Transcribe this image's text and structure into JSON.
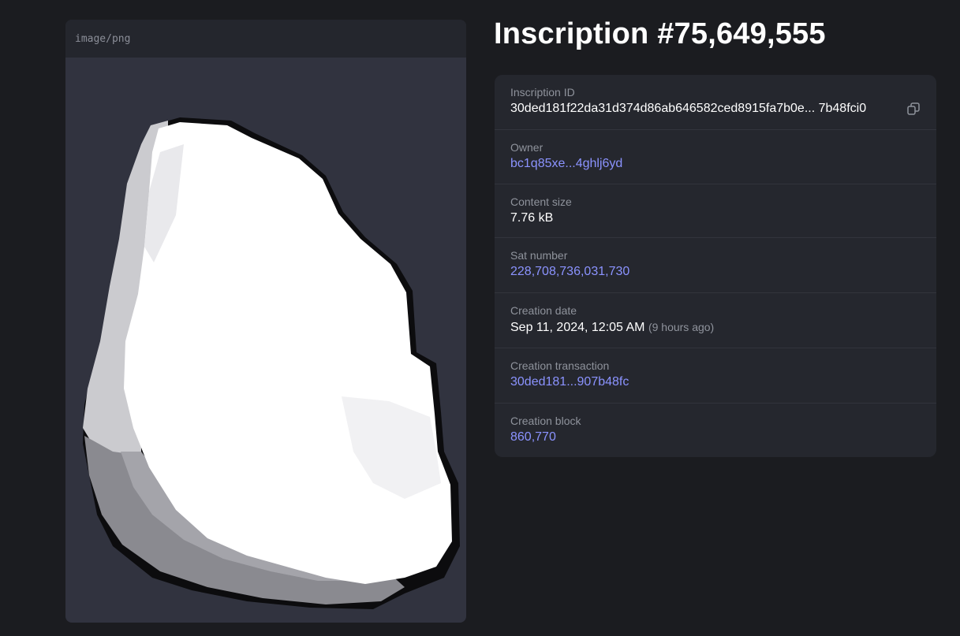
{
  "preview": {
    "mime_type": "image/png"
  },
  "title": "Inscription #75,649,555",
  "details": {
    "inscription_id": {
      "label": "Inscription ID",
      "value": "30ded181f22da31d374d86ab646582ced8915fa7b0e... 7b48fci0"
    },
    "owner": {
      "label": "Owner",
      "value": "bc1q85xe...4ghlj6yd"
    },
    "content_size": {
      "label": "Content size",
      "value": "7.76 kB"
    },
    "sat_number": {
      "label": "Sat number",
      "value": "228,708,736,031,730"
    },
    "creation_date": {
      "label": "Creation date",
      "value": "Sep 11, 2024, 12:05 AM",
      "relative": "(9 hours ago)"
    },
    "creation_transaction": {
      "label": "Creation transaction",
      "value": "30ded181...907b48fc"
    },
    "creation_block": {
      "label": "Creation block",
      "value": "860,770"
    }
  },
  "icons": {
    "copy": "copy-icon"
  },
  "colors": {
    "background": "#1b1c20",
    "card": "#25272e",
    "link": "#8b93ff",
    "label": "#8f939c"
  }
}
